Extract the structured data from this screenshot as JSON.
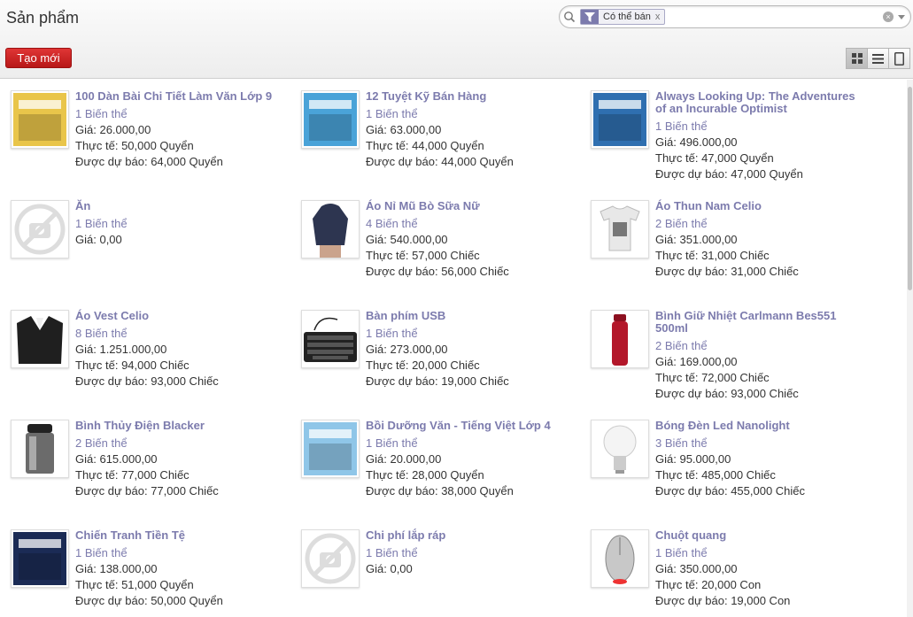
{
  "page_title": "Sản phẩm",
  "search": {
    "facet_label": "Có thể bán",
    "facet_remove": "x",
    "placeholder": ""
  },
  "create_button": "Tạo mới",
  "labels": {
    "price": "Giá: ",
    "on_hand": "Thực tế: ",
    "forecast": "Được dự báo: "
  },
  "products": [
    {
      "name": "100 Dàn Bài Chi Tiết Làm Văn Lớp 9",
      "variants": "1 Biến thể",
      "price": "26.000,00",
      "on_hand": "50,000 Quyển",
      "forecast": "64,000 Quyển",
      "icon": "book-cover-icon",
      "thumb_color": "#e9c54a"
    },
    {
      "name": "12 Tuyệt Kỹ Bán Hàng",
      "variants": "1 Biến thể",
      "price": "63.000,00",
      "on_hand": "44,000 Quyển",
      "forecast": "44,000 Quyển",
      "icon": "book-cover-icon",
      "thumb_color": "#4aa3d8"
    },
    {
      "name": "Always Looking Up: The Adventures of an Incurable Optimist",
      "variants": "1 Biến thể",
      "price": "496.000,00",
      "on_hand": "47,000 Quyển",
      "forecast": "47,000 Quyển",
      "icon": "book-cover-icon",
      "thumb_color": "#2f6fb0"
    },
    {
      "name": "Ăn",
      "variants": "1 Biến thể",
      "price": "0,00",
      "icon": "no-image-icon",
      "thumb_color": "#dddddd"
    },
    {
      "name": "Áo Nỉ Mũ Bò Sữa Nữ",
      "variants": "4 Biến thể",
      "price": "540.000,00",
      "on_hand": "57,000 Chiếc",
      "forecast": "56,000 Chiếc",
      "icon": "hoodie-icon",
      "thumb_color": "#2d3550"
    },
    {
      "name": "Áo Thun Nam Celio",
      "variants": "2 Biến thể",
      "price": "351.000,00",
      "on_hand": "31,000 Chiếc",
      "forecast": "31,000 Chiếc",
      "icon": "tshirt-icon",
      "thumb_color": "#e8e8e8"
    },
    {
      "name": "Áo Vest Celio",
      "variants": "8 Biến thể",
      "price": "1.251.000,00",
      "on_hand": "94,000 Chiếc",
      "forecast": "93,000 Chiếc",
      "icon": "suit-jacket-icon",
      "thumb_color": "#1f1f1f"
    },
    {
      "name": "Bàn phím USB",
      "variants": "1 Biến thể",
      "price": "273.000,00",
      "on_hand": "20,000 Chiếc",
      "forecast": "19,000 Chiếc",
      "icon": "keyboard-icon",
      "thumb_color": "#222222"
    },
    {
      "name": "Bình Giữ Nhiệt Carlmann Bes551 500ml",
      "variants": "2 Biến thể",
      "price": "169.000,00",
      "on_hand": "72,000 Chiếc",
      "forecast": "93,000 Chiếc",
      "icon": "thermos-bottle-icon",
      "thumb_color": "#b3172a"
    },
    {
      "name": "Bình Thủy Điện Blacker",
      "variants": "2 Biến thể",
      "price": "615.000,00",
      "on_hand": "77,000 Chiếc",
      "forecast": "77,000 Chiếc",
      "icon": "water-boiler-icon",
      "thumb_color": "#6b6b6b"
    },
    {
      "name": "Bồi Dưỡng Văn - Tiếng Việt Lớp 4",
      "variants": "1 Biến thể",
      "price": "20.000,00",
      "on_hand": "28,000 Quyển",
      "forecast": "38,000 Quyển",
      "icon": "book-cover-icon",
      "thumb_color": "#8fc6e8"
    },
    {
      "name": "Bóng Đèn Led Nanolight",
      "variants": "3 Biến thể",
      "price": "95.000,00",
      "on_hand": "485,000 Chiếc",
      "forecast": "455,000 Chiếc",
      "icon": "light-bulb-icon",
      "thumb_color": "#f2f2f2"
    },
    {
      "name": "Chiến Tranh Tiền Tệ",
      "variants": "1 Biến thể",
      "price": "138.000,00",
      "on_hand": "51,000 Quyển",
      "forecast": "50,000 Quyển",
      "icon": "book-cover-icon",
      "thumb_color": "#1b2b55"
    },
    {
      "name": "Chi phí lắp ráp",
      "variants": "1 Biến thể",
      "price": "0,00",
      "icon": "no-image-icon",
      "thumb_color": "#dddddd"
    },
    {
      "name": "Chuột quang",
      "variants": "1 Biến thể",
      "price": "350.000,00",
      "on_hand": "20,000 Con",
      "forecast": "19,000 Con",
      "icon": "computer-mouse-icon",
      "thumb_color": "#c8c8c8"
    }
  ]
}
